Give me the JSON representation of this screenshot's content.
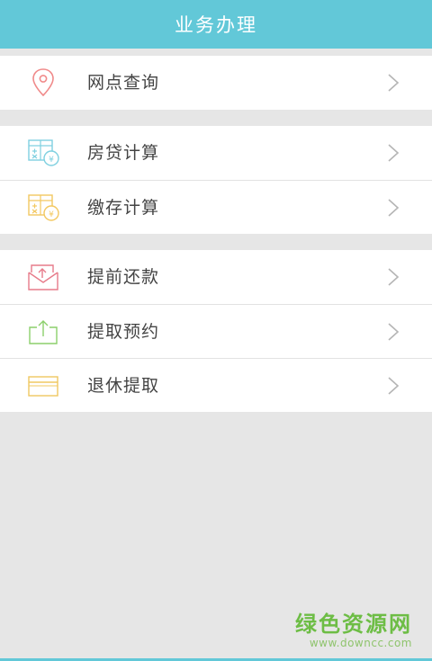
{
  "header": {
    "title": "业务办理"
  },
  "groups": [
    {
      "items": [
        {
          "label": "网点查询",
          "icon": "location-pin-icon"
        }
      ]
    },
    {
      "items": [
        {
          "label": "房贷计算",
          "icon": "calculator-house-icon"
        },
        {
          "label": "缴存计算",
          "icon": "calculator-deposit-icon"
        }
      ]
    },
    {
      "items": [
        {
          "label": "提前还款",
          "icon": "envelope-upload-icon"
        },
        {
          "label": "提取预约",
          "icon": "tray-upload-icon"
        },
        {
          "label": "退休提取",
          "icon": "card-icon"
        }
      ]
    }
  ],
  "watermark": {
    "cn": "绿色资源网",
    "url": "www.downcc.com"
  },
  "colors": {
    "header": "#62c8d8",
    "pin": "#f08a8a",
    "calc_blue": "#7fd0e0",
    "calc_yellow": "#f3c860",
    "envelope": "#e77b8a",
    "tray": "#8bcf6b",
    "card": "#f0c860"
  }
}
